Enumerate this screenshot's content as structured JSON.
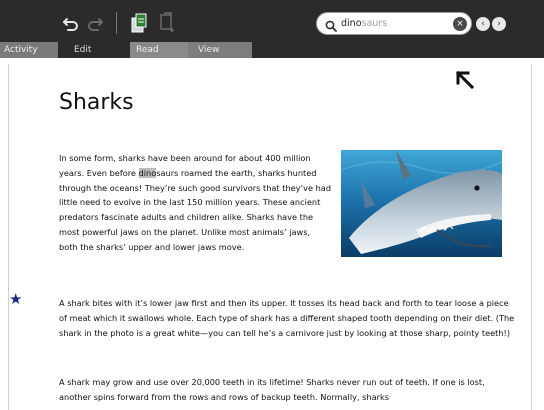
{
  "toolbar": {
    "undo_icon": "undo-icon",
    "redo_icon": "redo-icon",
    "copy_icon": "copy-icon",
    "paste_icon": "paste-icon"
  },
  "search": {
    "typed": "dino",
    "completion": "saurs",
    "clear_glyph": "×",
    "prev_glyph": "‹",
    "next_glyph": "›"
  },
  "tabs": {
    "activity": "Activity",
    "edit": "Edit",
    "read": "Read",
    "view": "View"
  },
  "document": {
    "title": "Sharks",
    "para1_a": "In some form, sharks have been around for about 400 million years. Even before ",
    "para1_hl": "dino",
    "para1_b": "saurs roamed the earth, sharks hunted through the oceans! They’re such good survivors that they’ve had little need to evolve in the last 150 million years. These ancient predators fascinate adults and children alike. Sharks have the most powerful jaws on the planet. Unlike most animals’ jaws, both the sharks’ upper and lower jaws move.",
    "para2": "A shark bites with it’s lower jaw first and then its upper. It tosses its head back and forth to tear loose a piece of meat which it swallows whole. Each type of shark has a different shaped tooth depending on their diet. (The shark in the photo is a great white—you can tell he’s a carnivore just by looking at those sharp, pointy teeth!)",
    "para3": "A shark may grow and use over 20,000 teeth in its lifetime! Sharks never run out of teeth. If one is lost, another spins forward from the rows and rows of backup teeth. Normally, sharks"
  },
  "colors": {
    "toolbar_bg": "#2b2b2b",
    "highlight": "#bdbdbd",
    "bookmark_star": "#1a2a8a"
  }
}
